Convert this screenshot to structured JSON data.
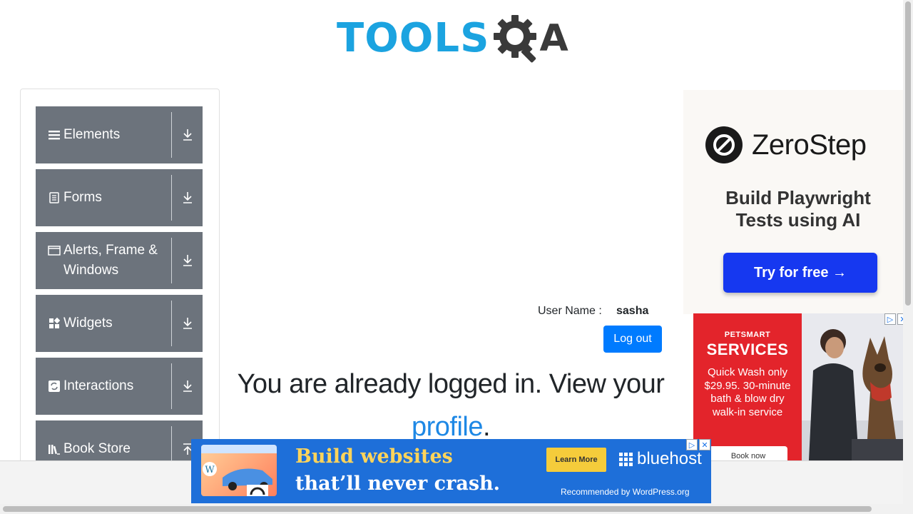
{
  "header": {
    "logo_text": "TOOLS",
    "logo_suffix": "A"
  },
  "sidebar": {
    "groups": [
      {
        "label": "Elements",
        "icon": "hamburger-icon"
      },
      {
        "label": "Forms",
        "icon": "document-icon"
      },
      {
        "label": "Alerts, Frame & Windows",
        "icon": "window-icon"
      },
      {
        "label": "Widgets",
        "icon": "widgets-icon"
      },
      {
        "label": "Interactions",
        "icon": "interactions-icon"
      },
      {
        "label": "Book Store",
        "icon": "books-icon"
      }
    ]
  },
  "main": {
    "username_label": "User Name :",
    "username_value": "sasha",
    "logout_label": "Log out",
    "message_prefix": "You are already logged in. View your",
    "profile_link": "profile",
    "message_suffix": "."
  },
  "ads": {
    "zerostep": {
      "brand": "ZeroStep",
      "tagline_line1": "Build Playwright",
      "tagline_line2": "Tests using AI",
      "cta": "Try for free →",
      "cta_color": "#1638f0"
    },
    "petsmart": {
      "brand": "PETSMART",
      "title": "SERVICES",
      "copy": "Quick Wash only $29.95. 30-minute bath & blow dry walk-in service",
      "cta": "Book now",
      "bg_color": "#e3242b"
    },
    "bluehost": {
      "headline_line1": "Build websites",
      "headline_line2": "that’ll never crash.",
      "cta": "Learn More",
      "brand": "bluehost",
      "recommend": "Recommended by WordPress.org",
      "bg_color": "#1e6fd9"
    }
  },
  "colors": {
    "sidebar_group": "#6c737c",
    "logout_button": "#007bff",
    "link": "#1e88e5",
    "logo_blue": "#1ba3e0"
  }
}
